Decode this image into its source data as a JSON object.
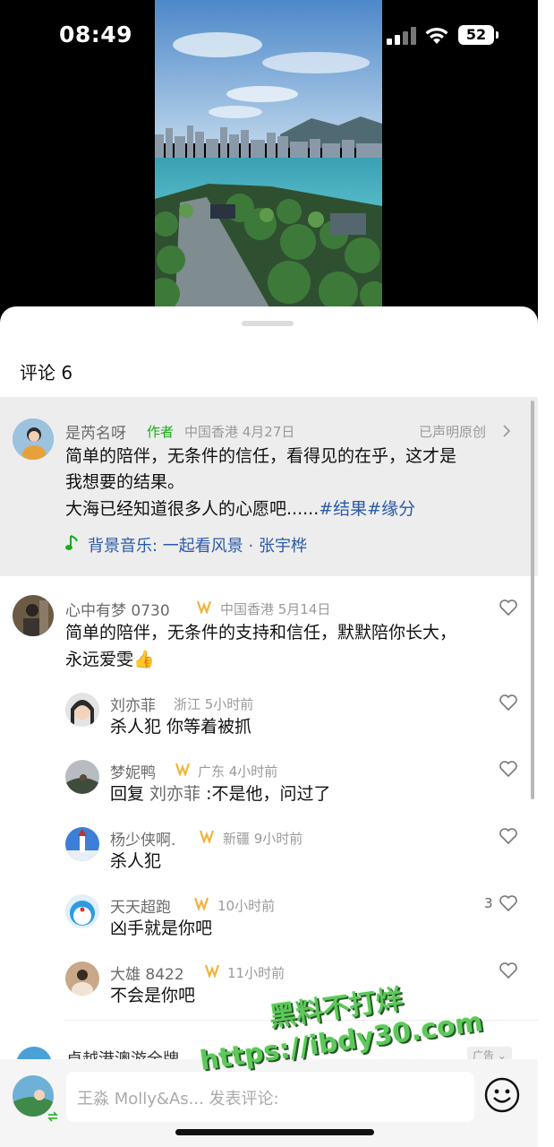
{
  "status_bar": {
    "time": "08:49",
    "battery": "52"
  },
  "sheet": {
    "title": "评论 6"
  },
  "author_post": {
    "username": "是芮名呀",
    "author_tag": "作者",
    "location_date": "中国香港 4月27日",
    "original_label": "已声明原创",
    "line1": "简单的陪伴，无条件的信任，看得见的在乎，这才是",
    "line2": "我想要的结果。",
    "line3_text": "大海已经知道很多人的心愿吧......",
    "hashtags": "#结果#缘分",
    "music": "背景音乐: 一起看风景 · 张宇桦"
  },
  "comment": {
    "username": "心中有梦 0730",
    "meta": "中国香港 5月14日",
    "line1": "简单的陪伴，无条件的支持和信任，默默陪你长大，",
    "line2": "永远爱雯👍"
  },
  "replies": [
    {
      "username": "刘亦菲",
      "meta": "浙江 5小时前",
      "text": "杀人犯 你等着被抓",
      "has_badge": false
    },
    {
      "username": "梦妮鸭",
      "meta": "广东 4小时前",
      "prefix": "回复 ",
      "reply_to": "刘亦菲",
      "text": " :不是他，问过了",
      "has_badge": true
    },
    {
      "username": "杨少侠啊.",
      "meta": "新疆 9小时前",
      "text": "杀人犯",
      "has_badge": true
    },
    {
      "username": "天天超跑",
      "meta": "10小时前",
      "text": "凶手就是你吧",
      "has_badge": true,
      "likes": "3"
    },
    {
      "username": "大雄 8422",
      "meta": "11小时前",
      "text": "不会是你吧",
      "has_badge": true
    }
  ],
  "ad": {
    "name": "卓越港澳游全牌",
    "tag": "广告 ⌄"
  },
  "input": {
    "placeholder": "王淼 Molly&As... 发表评论:"
  },
  "watermark": {
    "line1": "黑料不打烊",
    "line2": "https://ibdy30.com"
  },
  "colors": {
    "accent_green": "#1aad19",
    "link_blue": "#2b5aa8",
    "badge_gold": "#f2b43c"
  }
}
